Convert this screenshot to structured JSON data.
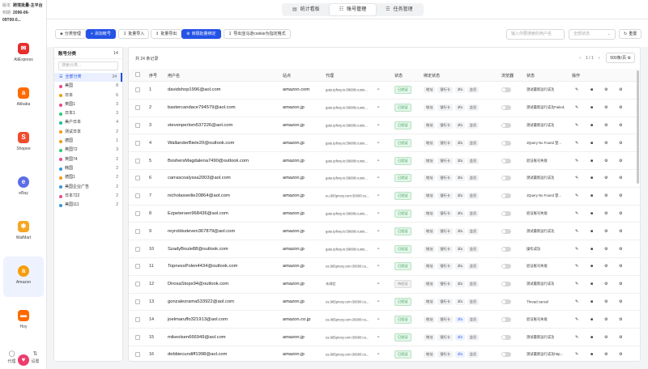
{
  "rail": {
    "version_label": "版本",
    "version_value": "跨境批量-主平台",
    "date_label": "到期",
    "date_value": "2096-06-09T00:0...",
    "platforms": [
      {
        "name": "AliExpress",
        "icon": "aliexpress-icon",
        "color": "#e62e2e",
        "glyph": "✉"
      },
      {
        "name": "Alibaba",
        "icon": "alibaba-icon",
        "color": "#ff6a00",
        "glyph": "a"
      },
      {
        "name": "Shopee",
        "icon": "shopee-icon",
        "color": "#ee4d2d",
        "glyph": "S"
      },
      {
        "name": "eBay",
        "icon": "ebay-icon",
        "color": "#5b6ee6",
        "glyph": "e"
      },
      {
        "name": "WalMart",
        "icon": "walmart-icon",
        "color": "#f5a623",
        "glyph": "✱"
      },
      {
        "name": "Amazon",
        "icon": "amazon-icon",
        "color": "#f59e0b",
        "glyph": "a"
      },
      {
        "name": "Hoy",
        "icon": "hoy-icon",
        "color": "#ff6a00",
        "glyph": "▬"
      },
      {
        "name": "Lazada",
        "icon": "lazada-icon",
        "color": "#ee3c6c",
        "glyph": "♥"
      }
    ],
    "bottom": [
      {
        "label": "代理",
        "icon": "proxy-icon"
      },
      {
        "label": "设置",
        "icon": "settings-icon"
      }
    ]
  },
  "tabs": [
    {
      "label": "统计看板",
      "icon": "dashboard-icon",
      "active": false
    },
    {
      "label": "账号管理",
      "icon": "account-icon",
      "active": true
    },
    {
      "label": "任务管理",
      "icon": "task-icon",
      "active": false
    }
  ],
  "toolbar": {
    "group_manage": "分类管理",
    "add_account": "添加帐号",
    "bulk_import": "批量导入",
    "bulk_export": "批量导出",
    "bulk_bind": "商隔批量绑定",
    "export_cookie": "导出亚马逊cookie为指定格式",
    "search_placeholder": "输入你要搜索的用户名",
    "status_placeholder": "全部状态",
    "refresh": "重置"
  },
  "categories": {
    "title": "账号分类",
    "count": "14",
    "search_placeholder": "搜索分类...",
    "all": {
      "label": "全部分类",
      "count": "24"
    },
    "items": [
      {
        "name": "美国",
        "count": "8",
        "color": "#e94b8a"
      },
      {
        "name": "日本",
        "count": "6",
        "color": "#f39c12"
      },
      {
        "name": "英国1",
        "count": "3",
        "color": "#e94b8a"
      },
      {
        "name": "日本1",
        "count": "3",
        "color": "#2ecc71"
      },
      {
        "name": "美户日本",
        "count": "4",
        "color": "#1abc9c"
      },
      {
        "name": "测试日本",
        "count": "2",
        "color": "#f39c12"
      },
      {
        "name": "德国",
        "count": "1",
        "color": "#f39c12"
      },
      {
        "name": "英国72",
        "count": "3",
        "color": "#2ecc71"
      },
      {
        "name": "英国74",
        "count": "2",
        "color": "#e94b8a"
      },
      {
        "name": "韩国",
        "count": "2",
        "color": "#3498db"
      },
      {
        "name": "德国1",
        "count": "2",
        "color": "#f39c12"
      },
      {
        "name": "美国企业广告",
        "count": "2",
        "color": "#3498db"
      },
      {
        "name": "日本722",
        "count": "2",
        "color": "#e94b8a"
      },
      {
        "name": "美国111",
        "count": "2",
        "color": "#3498db"
      }
    ]
  },
  "table": {
    "total": "共 24 条记录",
    "page": "1 / 1",
    "page_size": "500条/页",
    "headers": {
      "idx": "序号",
      "user": "用户名",
      "site": "站点",
      "proxy": "代理",
      "state": "状态",
      "bind": "绑定状态",
      "browser": "浏览器",
      "status": "状态",
      "actions": "操作"
    },
    "bind_labels": [
      "地址",
      "银行卡",
      "2fa",
      "会员"
    ],
    "rows": [
      {
        "idx": "1",
        "user": "davidshop1996@aol.com",
        "site": "amazon.com",
        "proxy": "gate.ipfoxy.io:58688:custo...",
        "state": "已验证",
        "state_type": "ok",
        "status": "测试最新运行成功"
      },
      {
        "idx": "2",
        "user": "baxtercandace794579@aol.com",
        "site": "amazon.jp",
        "proxy": "gate.ipfoxy.io:58688:custo...",
        "state": "已验证",
        "state_type": "ok",
        "status": "测试最新运行成功Failed..."
      },
      {
        "idx": "3",
        "user": "stevenperlom537226@aol.com",
        "site": "amazon.jp",
        "proxy": "gate.ipfoxy.io:58688:custo...",
        "state": "已验证",
        "state_type": "ok",
        "status": "测试最新运行成功"
      },
      {
        "idx": "4",
        "user": "WallanderBiele20@outlook.com",
        "site": "amazon.jp",
        "proxy": "gate.ipfoxy.io:58688:custo...",
        "state": "已验证",
        "state_type": "ok",
        "status": "JQuery No Found 登..."
      },
      {
        "idx": "5",
        "user": "BoshersMagdalena7490@outlook.com",
        "site": "amazon.jp",
        "proxy": "gate.ipfoxy.io:58688:custo...",
        "state": "已验证",
        "state_type": "ok",
        "status": "验证账号失败"
      },
      {
        "idx": "6",
        "user": "carrascoalyssa2003@aol.com",
        "site": "amazon.jp",
        "proxy": "gate.ipfoxy.io:58688:custo...",
        "state": "已验证",
        "state_type": "ok",
        "status": "测试最新运行成功"
      },
      {
        "idx": "7",
        "user": "nicholasseilie20864@aol.com",
        "site": "amazon.jp",
        "proxy": "eu.965proxy.com:30000:cu...",
        "state": "已验证",
        "state_type": "ok",
        "status": "JQuery No Found 登..."
      },
      {
        "idx": "8",
        "user": "Ezpetersen968436@aol.com",
        "site": "amazon.jp",
        "proxy": "gate.ipfoxy.io:58688:custo...",
        "state": "已验证",
        "state_type": "ok",
        "status": "验证账号失败"
      },
      {
        "idx": "9",
        "user": "reyroldssteven367879@aol.com",
        "site": "amazon.jp",
        "proxy": "gate.ipfoxy.io:58688:custo...",
        "state": "已验证",
        "state_type": "ok",
        "status": "测试最新运行成功"
      },
      {
        "idx": "10",
        "user": "SzadyBoule88@outlook.com",
        "site": "amazon.jp",
        "proxy": "gate.ipfoxy.io:58688:custo...",
        "state": "已验证",
        "state_type": "ok",
        "status": "操作成功"
      },
      {
        "idx": "11",
        "user": "TopnessPolen4434@outlook.com",
        "site": "amazon.jp",
        "proxy": "us.965proxy.com:30000:cu...",
        "state": "已验证",
        "state_type": "ok",
        "status": "验证账号失败"
      },
      {
        "idx": "12",
        "user": "DirosaStops94@outlook.com",
        "site": "amazon.jp",
        "proxy": "未绑定",
        "state": "待验证",
        "state_type": "pending",
        "status": "测试最新运行成功"
      },
      {
        "idx": "13",
        "user": "gonzalezrama533922@aol.com",
        "site": "amazon.jp",
        "proxy": "us.965proxy.com:30000:cu...",
        "state": "已验证",
        "state_type": "ok",
        "status": "Thread cancel"
      },
      {
        "idx": "14",
        "user": "joelmaruffo321913@aol.com",
        "site": "amazon.co.jp",
        "proxy": "us.965proxy.com:30000:cu...",
        "state": "已验证",
        "state_type": "ok",
        "status": "验证账号失败"
      },
      {
        "idx": "15",
        "user": "mikeolsen666949@aol.com",
        "site": "amazon.jp",
        "proxy": "us.965proxy.com:30000:cu...",
        "state": "已验证",
        "state_type": "ok",
        "status": "测试最新运行成功"
      },
      {
        "idx": "16",
        "user": "debbiecundiff1998@aol.com",
        "site": "amazon.jp",
        "proxy": "us.965proxy.com:30000:cu...",
        "state": "已验证",
        "state_type": "ok",
        "status": "测试最新运行成功http..."
      }
    ]
  }
}
